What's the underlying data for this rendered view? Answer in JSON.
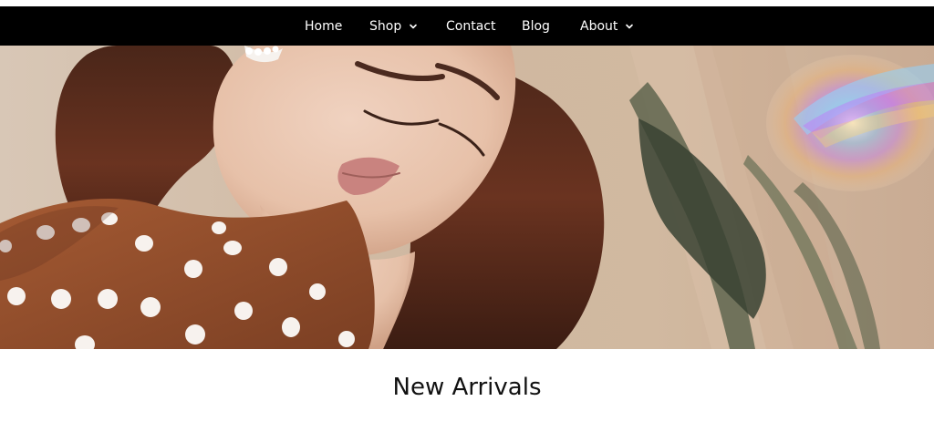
{
  "nav": {
    "items": [
      {
        "label": "Home",
        "has_dropdown": false
      },
      {
        "label": "Shop",
        "has_dropdown": true
      },
      {
        "label": "Contact",
        "has_dropdown": false
      },
      {
        "label": "Blog",
        "has_dropdown": false
      },
      {
        "label": "About",
        "has_dropdown": true
      }
    ]
  },
  "hero": {
    "image_alt": "Woman in brown polka-dot blouse with wavy hair"
  },
  "section": {
    "title": "New Arrivals"
  },
  "colors": {
    "nav_background": "#000000",
    "nav_text": "#ffffff",
    "hero_background": "#d2bea9",
    "title_text": "#111111"
  }
}
